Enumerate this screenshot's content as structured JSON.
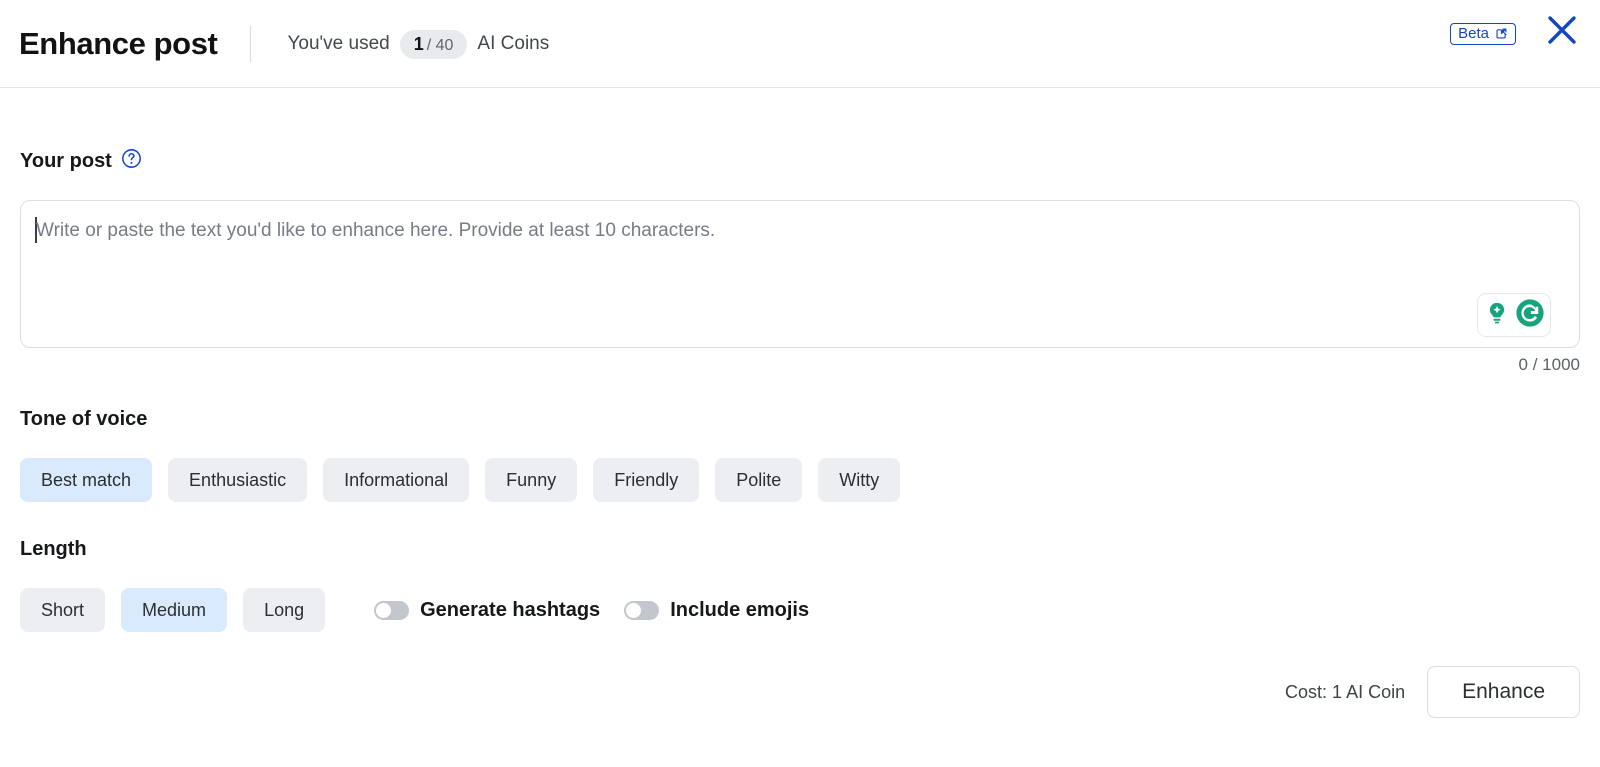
{
  "header": {
    "title": "Enhance post",
    "coins_prefix": "You've used",
    "coins_used": "1",
    "coins_total": "/ 40",
    "coins_suffix": "AI Coins",
    "beta_label": "Beta",
    "beta_icon": "external-link-icon",
    "close_icon": "close-icon",
    "accent_blue": "#1446c4"
  },
  "post": {
    "label": "Your post",
    "help_icon": "help-circle-icon",
    "placeholder": "Write or paste the text you'd like to enhance here. Provide at least 10 characters.",
    "value": "",
    "char_counter": "0 / 1000",
    "assistant": {
      "name": "grammarly-widget",
      "idea_icon": "lightbulb-icon",
      "brand_icon": "grammarly-logo-icon",
      "brand_color": "#15a47e"
    }
  },
  "tone": {
    "heading": "Tone of voice",
    "selected": "Best match",
    "options": [
      {
        "label": "Best match",
        "selected": true
      },
      {
        "label": "Enthusiastic",
        "selected": false
      },
      {
        "label": "Informational",
        "selected": false
      },
      {
        "label": "Funny",
        "selected": false
      },
      {
        "label": "Friendly",
        "selected": false
      },
      {
        "label": "Polite",
        "selected": false
      },
      {
        "label": "Witty",
        "selected": false
      }
    ]
  },
  "length": {
    "heading": "Length",
    "selected": "Medium",
    "options": [
      {
        "label": "Short",
        "selected": false
      },
      {
        "label": "Medium",
        "selected": true
      },
      {
        "label": "Long",
        "selected": false
      }
    ]
  },
  "toggles": [
    {
      "label": "Generate hashtags",
      "on": false
    },
    {
      "label": "Include emojis",
      "on": false
    }
  ],
  "footer": {
    "cost": "Cost: 1 AI Coin",
    "submit_label": "Enhance"
  },
  "theme": {
    "chip_bg": "#eceef1",
    "chip_selected_bg": "#d9eafc",
    "border": "#dcdee3"
  }
}
